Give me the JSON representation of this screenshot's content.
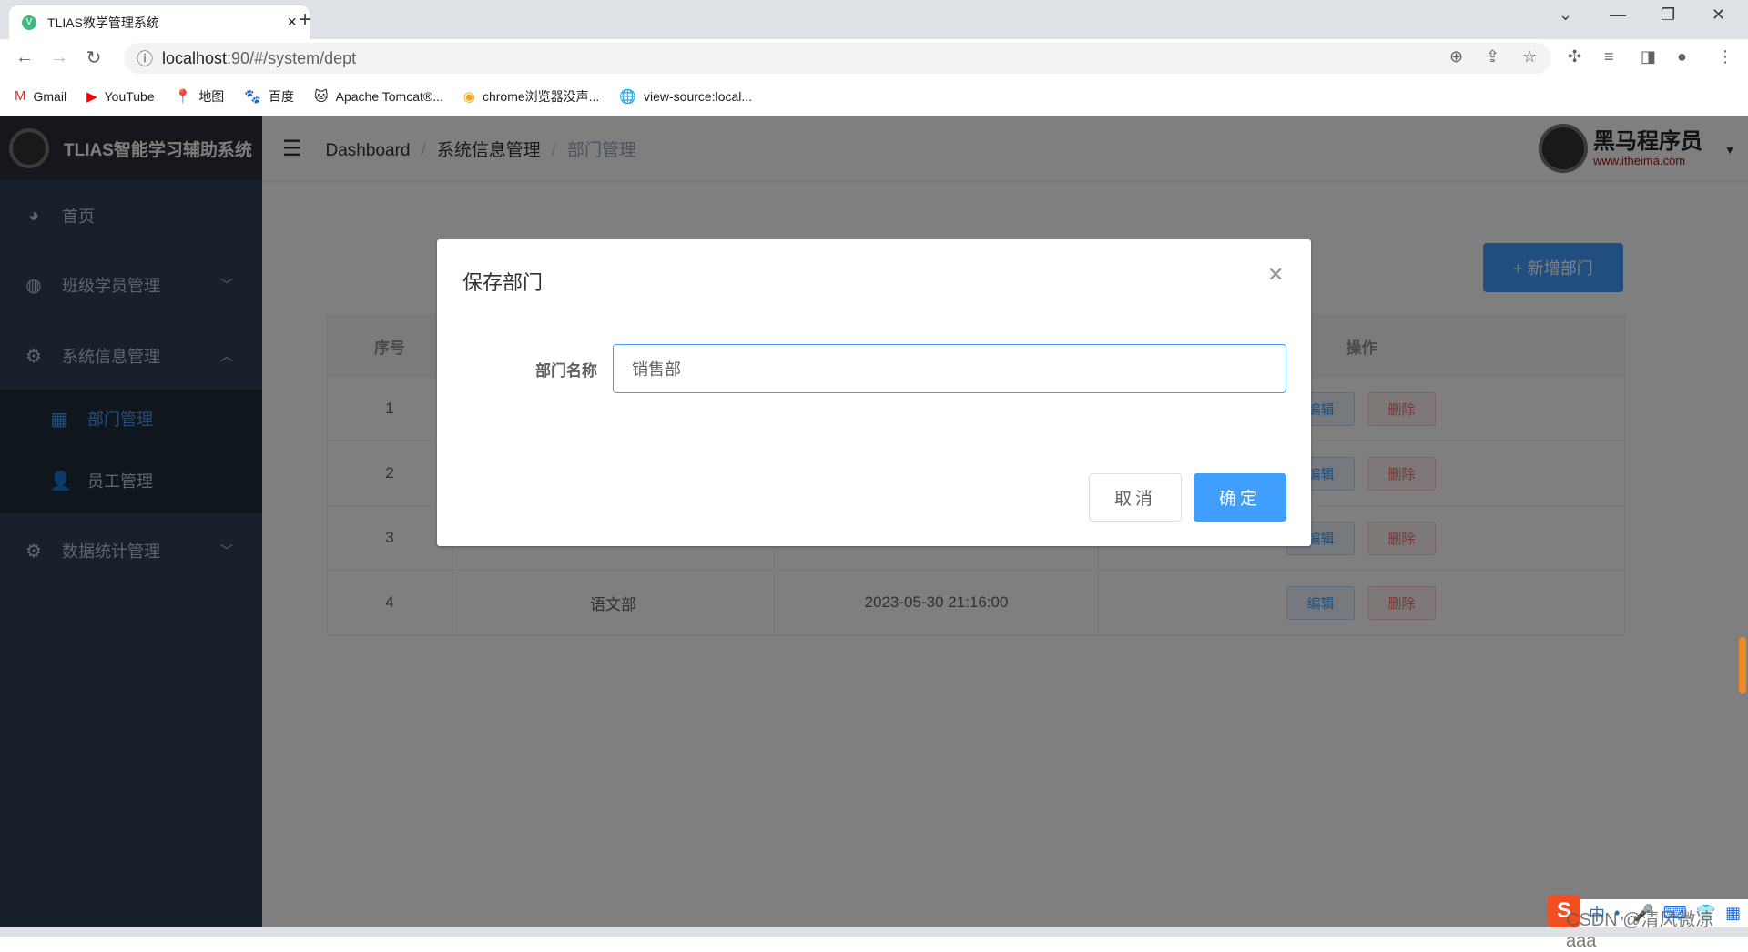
{
  "browser": {
    "tab_title": "TLIAS教学管理系统",
    "url_host": "localhost",
    "url_path": ":90/#/system/dept",
    "bookmarks": [
      {
        "icon": "gmail-icon",
        "glyph": "M",
        "label": "Gmail"
      },
      {
        "icon": "youtube-icon",
        "glyph": "▶",
        "label": "YouTube"
      },
      {
        "icon": "maps-icon",
        "glyph": "📍",
        "label": "地图"
      },
      {
        "icon": "baidu-icon",
        "glyph": "🐾",
        "label": "百度"
      },
      {
        "icon": "tomcat-icon",
        "glyph": "🐱",
        "label": "Apache Tomcat®..."
      },
      {
        "icon": "chrome-ext-icon",
        "glyph": "◉",
        "label": "chrome浏览器没声..."
      },
      {
        "icon": "globe-icon",
        "glyph": "🌐",
        "label": "view-source:local..."
      }
    ]
  },
  "app": {
    "logo_text": "TLIAS智能学习辅助系统",
    "sidebar": [
      {
        "icon": "dashboard-icon",
        "glyph": "◕",
        "label": "首页"
      },
      {
        "icon": "class-icon",
        "glyph": "◍",
        "label": "班级学员管理",
        "chevron": "﹀"
      },
      {
        "icon": "gear-icon",
        "glyph": "⚙",
        "label": "系统信息管理",
        "chevron": "︿"
      },
      {
        "icon": "grid-icon",
        "glyph": "▦",
        "label": "部门管理"
      },
      {
        "icon": "user-icon",
        "glyph": "👤",
        "label": "员工管理"
      },
      {
        "icon": "gear-icon",
        "glyph": "⚙",
        "label": "数据统计管理",
        "chevron": "﹀"
      }
    ],
    "breadcrumb": [
      "Dashboard",
      "系统信息管理",
      "部门管理"
    ],
    "brand": {
      "cn": "黑马程序员",
      "en": "www.itheima.com"
    },
    "add_button": "+ 新增部门",
    "table": {
      "headers": [
        "序号",
        "",
        "",
        "操作"
      ],
      "rows": [
        {
          "no": "1",
          "name": "",
          "time": ""
        },
        {
          "no": "2",
          "name": "",
          "time": ""
        },
        {
          "no": "3",
          "name": "",
          "time": ""
        },
        {
          "no": "4",
          "name": "语文部",
          "time": "2023-05-30 21:16:00"
        }
      ],
      "edit": "编辑",
      "delete": "删除"
    }
  },
  "dialog": {
    "title": "保存部门",
    "label": "部门名称",
    "value": "销售部",
    "cancel": "取消",
    "ok": "确定"
  },
  "watermark": "CSDN @清风微凉 aaa",
  "ime": {
    "lang": "中"
  },
  "colors": {
    "primary": "#409eff",
    "sidebar": "#304156",
    "danger": "#f56c6c"
  }
}
